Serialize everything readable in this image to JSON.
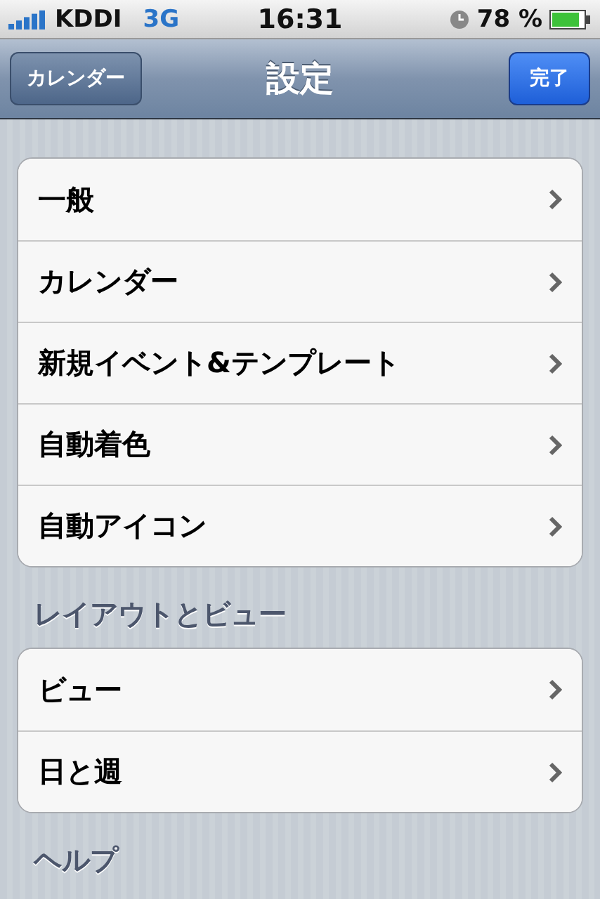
{
  "status_bar": {
    "carrier": "KDDI",
    "network": "3G",
    "time": "16:31",
    "battery": "78 %"
  },
  "nav_bar": {
    "back_button": "カレンダー",
    "title": "設定",
    "done_button": "完了"
  },
  "sections": [
    {
      "rows": [
        {
          "label": "一般"
        },
        {
          "label": "カレンダー"
        },
        {
          "label": "新規イベント&テンプレート"
        },
        {
          "label": "自動着色"
        },
        {
          "label": "自動アイコン"
        }
      ]
    },
    {
      "header": "レイアウトとビュー",
      "rows": [
        {
          "label": "ビュー"
        },
        {
          "label": "日と週"
        }
      ]
    },
    {
      "header": "ヘルプ"
    }
  ]
}
